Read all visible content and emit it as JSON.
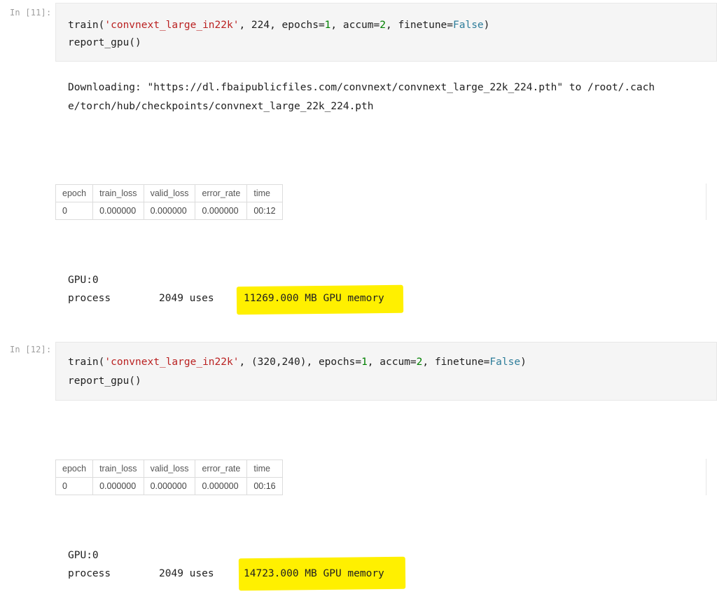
{
  "cells": [
    {
      "prompt": "In [11]:",
      "code": {
        "line1": {
          "fn": "train(",
          "str": "'convnext_large_in22k'",
          "mid": ", 224, epochs=",
          "n1": "1",
          "mid2": ", accum=",
          "n2": "2",
          "mid3": ", finetune=",
          "kw": "False",
          "end": ")"
        },
        "line2": "report_gpu()"
      },
      "stream": [
        "Downloading: \"https://dl.fbaipublicfiles.com/convnext/convnext_large_22k_224.pth\" to /root/.cach",
        "e/torch/hub/checkpoints/convnext_large_22k_224.pth"
      ],
      "table": {
        "headers": [
          "epoch",
          "train_loss",
          "valid_loss",
          "error_rate",
          "time"
        ],
        "row": [
          "0",
          "0.000000",
          "0.000000",
          "0.000000",
          "00:12"
        ]
      },
      "gpu": {
        "line1": "GPU:0",
        "process_label": "process",
        "uses": "2049 uses",
        "memory": "11269.000 MB GPU memory"
      }
    },
    {
      "prompt": "In [12]:",
      "code": {
        "line1": {
          "fn": "train(",
          "str": "'convnext_large_in22k'",
          "mid": ", (320,240), epochs=",
          "n1": "1",
          "mid2": ", accum=",
          "n2": "2",
          "mid3": ", finetune=",
          "kw": "False",
          "end": ")"
        },
        "line2": "report_gpu()"
      },
      "table": {
        "headers": [
          "epoch",
          "train_loss",
          "valid_loss",
          "error_rate",
          "time"
        ],
        "row": [
          "0",
          "0.000000",
          "0.000000",
          "0.000000",
          "00:16"
        ]
      },
      "gpu": {
        "line1": "GPU:0",
        "process_label": "process",
        "uses": "2049 uses",
        "memory": "14723.000 MB GPU memory"
      }
    }
  ],
  "colors": {
    "highlight": "#fff000",
    "string": "#ba2121",
    "number": "#008000",
    "keyword": "#2e7d9a",
    "input_bg": "#f5f5f5"
  }
}
